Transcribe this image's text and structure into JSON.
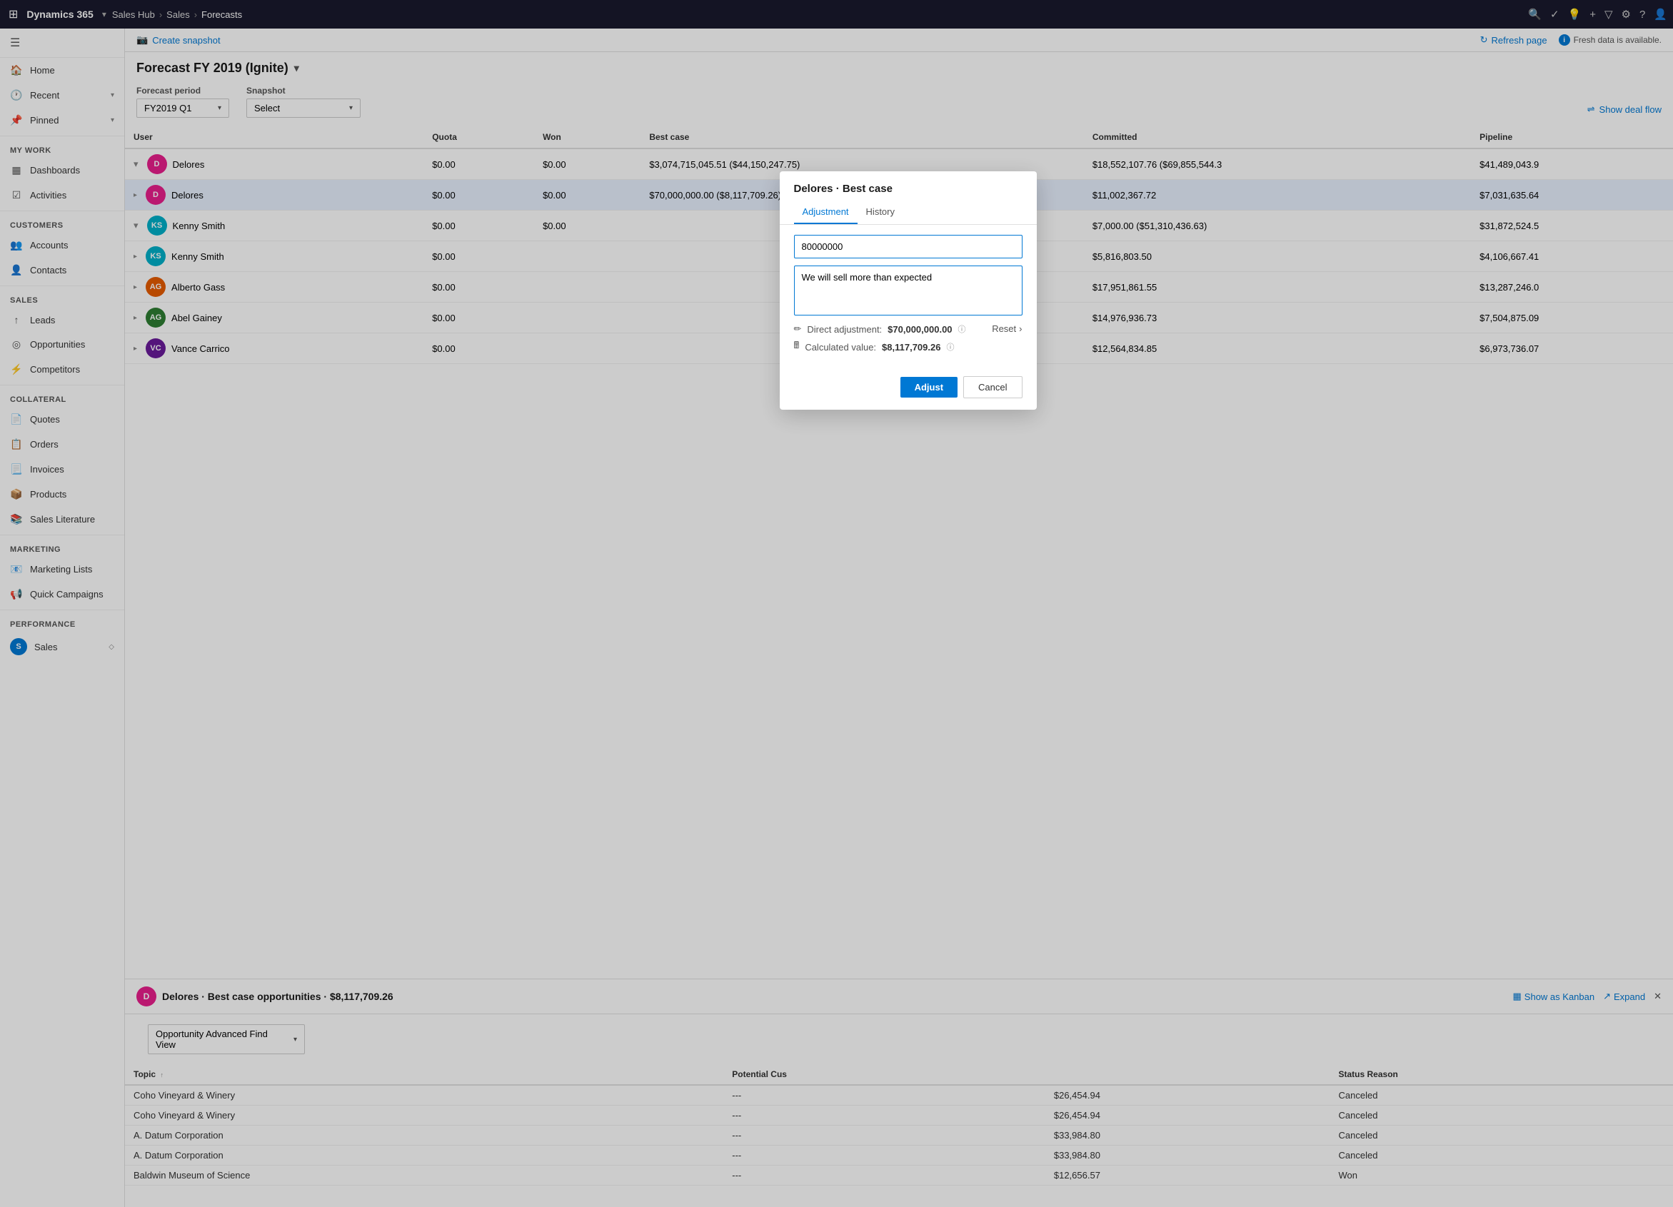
{
  "topnav": {
    "apps_icon": "⊞",
    "brand": "Dynamics 365",
    "module": "Sales Hub",
    "breadcrumb_parent": "Sales",
    "breadcrumb_sep": "›",
    "breadcrumb_current": "Forecasts",
    "nav_icons": [
      "🔍",
      "✓",
      "💡",
      "+",
      "▽",
      "👤",
      "⚙",
      "?",
      "👤"
    ]
  },
  "sidebar": {
    "toggle_icon": "☰",
    "items": [
      {
        "id": "home",
        "icon": "🏠",
        "label": "Home",
        "has_arrow": false
      },
      {
        "id": "recent",
        "icon": "🕐",
        "label": "Recent",
        "has_arrow": true
      },
      {
        "id": "pinned",
        "icon": "📌",
        "label": "Pinned",
        "has_arrow": true
      }
    ],
    "sections": [
      {
        "label": "My Work",
        "items": [
          {
            "id": "dashboards",
            "icon": "▦",
            "label": "Dashboards"
          },
          {
            "id": "activities",
            "icon": "☑",
            "label": "Activities"
          }
        ]
      },
      {
        "label": "Customers",
        "items": [
          {
            "id": "accounts",
            "icon": "👥",
            "label": "Accounts"
          },
          {
            "id": "contacts",
            "icon": "👤",
            "label": "Contacts"
          }
        ]
      },
      {
        "label": "Sales",
        "items": [
          {
            "id": "leads",
            "icon": "↑",
            "label": "Leads"
          },
          {
            "id": "opportunities",
            "icon": "◎",
            "label": "Opportunities"
          },
          {
            "id": "competitors",
            "icon": "⚡",
            "label": "Competitors"
          }
        ]
      },
      {
        "label": "Collateral",
        "items": [
          {
            "id": "quotes",
            "icon": "📄",
            "label": "Quotes"
          },
          {
            "id": "orders",
            "icon": "📋",
            "label": "Orders"
          },
          {
            "id": "invoices",
            "icon": "📃",
            "label": "Invoices"
          },
          {
            "id": "products",
            "icon": "📦",
            "label": "Products"
          },
          {
            "id": "sales_literature",
            "icon": "📚",
            "label": "Sales Literature"
          }
        ]
      },
      {
        "label": "Marketing",
        "items": [
          {
            "id": "marketing_lists",
            "icon": "📧",
            "label": "Marketing Lists"
          },
          {
            "id": "quick_campaigns",
            "icon": "📢",
            "label": "Quick Campaigns"
          }
        ]
      },
      {
        "label": "Performance",
        "items": [
          {
            "id": "sales_perf",
            "icon": "S",
            "label": "Sales",
            "is_badge": true
          }
        ]
      }
    ]
  },
  "action_bar": {
    "create_snapshot_icon": "📷",
    "create_snapshot_label": "Create snapshot",
    "refresh_label": "Refresh page",
    "fresh_data_label": "Fresh data is available."
  },
  "forecast": {
    "title": "Forecast FY 2019 (Ignite)",
    "period_label": "Forecast period",
    "period_value": "FY2019 Q1",
    "snapshot_label": "Snapshot",
    "snapshot_value": "Select",
    "show_deal_flow": "Show deal flow",
    "columns": [
      "User",
      "Quota",
      "Won",
      "Best case",
      "Committed",
      "Pipeline"
    ],
    "rows": [
      {
        "level": 0,
        "expanded": true,
        "avatar_color": "#e91e8c",
        "avatar_text": "D",
        "name": "Delores",
        "quota": "$0.00",
        "won": "$0.00",
        "best_case": "$3,074,715,045.51 ($44,150,247.75)",
        "committed": "$18,552,107.76 ($69,855,544.3",
        "pipeline": "$41,489,043.9"
      },
      {
        "level": 1,
        "expanded": false,
        "avatar_color": "#e91e8c",
        "avatar_text": "D",
        "name": "Delores",
        "quota": "$0.00",
        "won": "$0.00",
        "best_case": "$70,000,000.00 ($8,117,709.26)",
        "committed": "$11,002,367.72",
        "pipeline": "$7,031,635.64",
        "highlighted": true
      },
      {
        "level": 0,
        "expanded": true,
        "avatar_color": "#00b0c8",
        "avatar_text": "KS",
        "name": "Kenny Smith",
        "quota": "$0.00",
        "won": "$0.00",
        "best_case": "",
        "committed": "$7,000.00 ($51,310,436.63)",
        "pipeline": "$31,872,524.5"
      },
      {
        "level": 1,
        "expanded": false,
        "avatar_color": "#00b0c8",
        "avatar_text": "KS",
        "name": "Kenny Smith",
        "quota": "$0.00",
        "won": "",
        "best_case": "",
        "committed": "$5,816,803.50",
        "pipeline": "$4,106,667.41"
      },
      {
        "level": 1,
        "expanded": false,
        "avatar_color": "#e65c00",
        "avatar_text": "AG",
        "name": "Alberto Gass",
        "quota": "$0.00",
        "won": "",
        "best_case": "",
        "committed": "$17,951,861.55",
        "pipeline": "$13,287,246.0"
      },
      {
        "level": 1,
        "expanded": false,
        "avatar_color": "#2e7d32",
        "avatar_text": "AG",
        "name": "Abel Gainey",
        "quota": "$0.00",
        "won": "",
        "best_case": "",
        "committed": "$14,976,936.73",
        "pipeline": "$7,504,875.09"
      },
      {
        "level": 1,
        "expanded": false,
        "avatar_color": "#6a1b9a",
        "avatar_text": "VC",
        "name": "Vance Carrico",
        "quota": "$0.00",
        "won": "",
        "best_case": "",
        "committed": "$12,564,834.85",
        "pipeline": "$6,973,736.07"
      }
    ]
  },
  "bottom_panel": {
    "avatar_color": "#e91e8c",
    "avatar_text": "D",
    "title": "Delores · Best case opportunities · $8,117,709.26",
    "view_label": "Opportunity Advanced Find View",
    "show_as_kanban": "Show as Kanban",
    "expand_label": "Expand",
    "columns": [
      "Topic",
      "Potential Cus",
      "",
      "Status Reason"
    ],
    "rows": [
      {
        "topic": "Coho Vineyard & Winery",
        "potential": "---",
        "amount": "$26,454.94",
        "status": "Canceled"
      },
      {
        "topic": "Coho Vineyard & Winery",
        "potential": "---",
        "amount": "$26,454.94",
        "status": "Canceled"
      },
      {
        "topic": "A. Datum Corporation",
        "potential": "---",
        "amount": "$33,984.80",
        "status": "Canceled"
      },
      {
        "topic": "A. Datum Corporation",
        "potential": "---",
        "amount": "$33,984.80",
        "status": "Canceled"
      },
      {
        "topic": "Baldwin Museum of Science",
        "potential": "---",
        "amount": "$12,656.57",
        "status": "Won"
      }
    ]
  },
  "modal": {
    "title": "Delores · Best case",
    "tab_adjustment": "Adjustment",
    "tab_history": "History",
    "amount_value": "80000000",
    "note_value": "We will sell more than expected",
    "direct_adjustment_label": "Direct adjustment:",
    "direct_adjustment_value": "$70,000,000.00",
    "calculated_label": "Calculated value:",
    "calculated_value": "$8,117,709.26",
    "reset_label": "Reset",
    "adjust_button": "Adjust",
    "cancel_button": "Cancel"
  }
}
